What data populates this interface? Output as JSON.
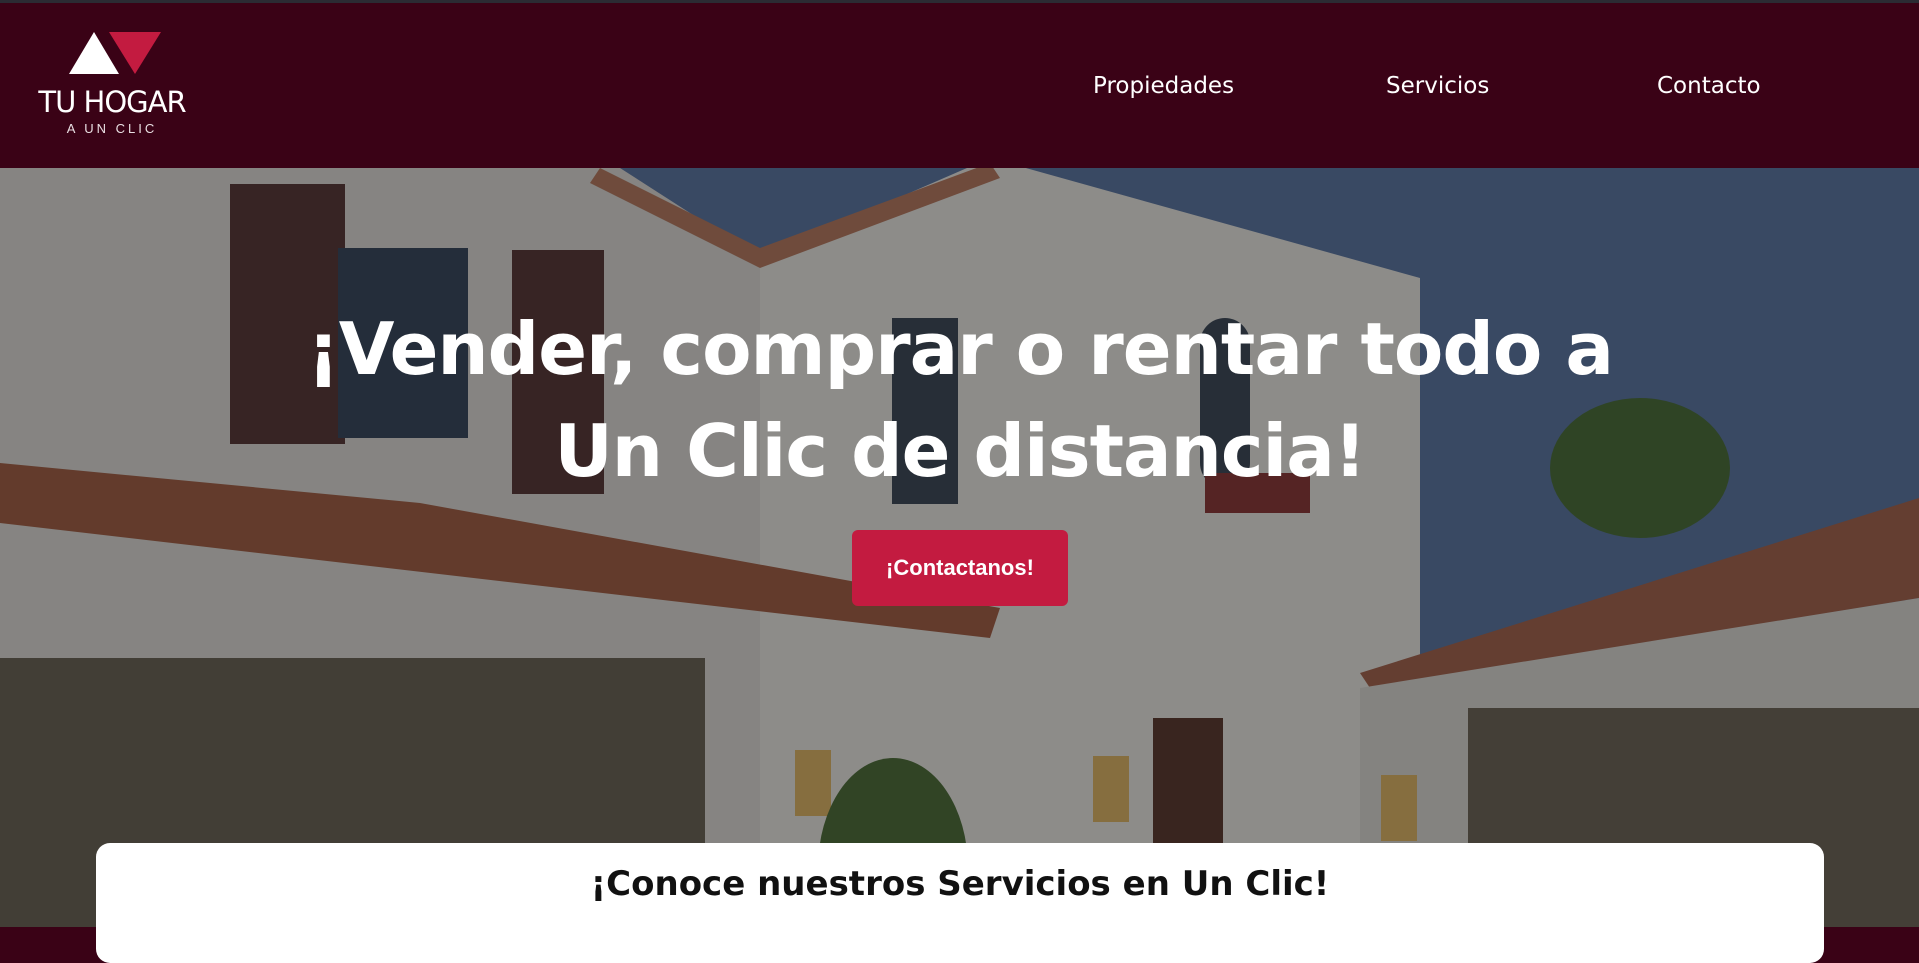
{
  "brand": {
    "title": "TU HOGAR",
    "subtitle": "A UN CLIC",
    "icon": "house-triangle-logo",
    "accent_color": "#c31b40",
    "header_color": "#3a0216"
  },
  "nav": {
    "items": [
      {
        "label": "Propiedades"
      },
      {
        "label": "Servicios"
      },
      {
        "label": "Contacto"
      }
    ]
  },
  "hero": {
    "headline": "¡Vender, comprar o rentar todo a Un Clic de distancia!",
    "cta_label": "¡Contactanos!"
  },
  "services": {
    "heading": "¡Conoce nuestros Servicios en Un Clic!"
  }
}
